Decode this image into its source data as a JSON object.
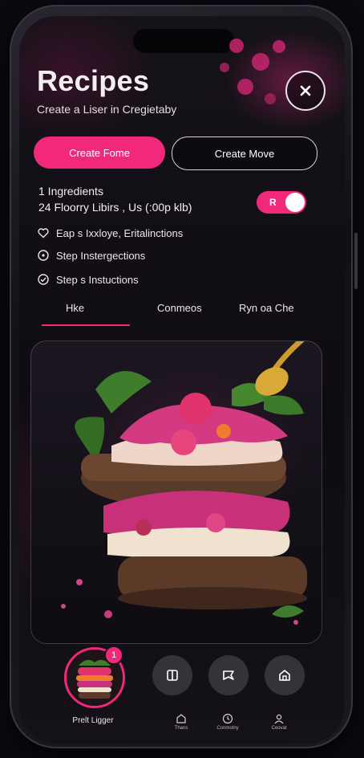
{
  "header": {
    "title": "Recipes",
    "subtitle": "Create a Liser in Cregietaby"
  },
  "actions": {
    "primary_label": "Create Fome",
    "secondary_label": "Create Move"
  },
  "info": {
    "line1": "1  Ingredients",
    "line2": "24 Floorry Libirs , Us (:00p klb)"
  },
  "toggle": {
    "label": "R",
    "on": true
  },
  "steps": [
    {
      "text": "Eap s Ixxloye, Eritalinctions",
      "icon": "heart-icon"
    },
    {
      "text": "Step Instergections",
      "icon": "circle-icon"
    },
    {
      "text": "Step s Instuctions",
      "icon": "check-circle-icon"
    }
  ],
  "tabs": [
    {
      "label": "Hke",
      "active": true
    },
    {
      "label": "Conmeos",
      "active": false
    },
    {
      "label": "Ryn oa Che",
      "active": false
    }
  ],
  "dish": {
    "label": "Prelt Ligger",
    "badge": "1"
  },
  "bottom_nav": [
    {
      "label": "Thans",
      "icon": "home-icon"
    },
    {
      "label": "Conmotny",
      "icon": "clock-icon"
    },
    {
      "label": "Ceovat",
      "icon": "user-icon"
    }
  ],
  "colors": {
    "accent": "#f2287a",
    "background": "#0e0c12"
  }
}
